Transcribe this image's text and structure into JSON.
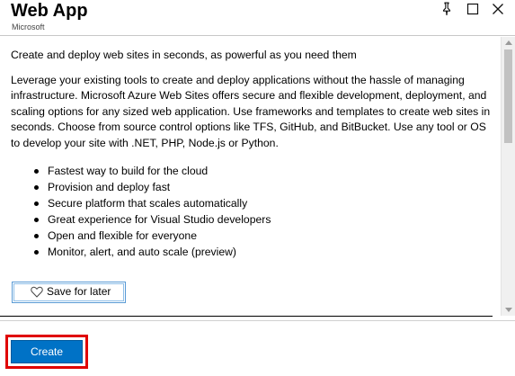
{
  "header": {
    "title": "Web App",
    "subtitle": "Microsoft"
  },
  "icons": {
    "pin": "pin-icon",
    "maximize": "maximize-icon",
    "close": "close-icon",
    "heart": "heart-icon"
  },
  "content": {
    "lead": "Create and deploy web sites in seconds, as powerful as you need them",
    "description": "Leverage your existing tools to create and deploy applications without the hassle of managing infrastructure. Microsoft Azure Web Sites offers secure and flexible development, deployment, and scaling options for any sized web application. Use frameworks and templates to create web sites in seconds. Choose from source control options like TFS, GitHub, and BitBucket. Use any tool or OS to develop your site with .NET, PHP, Node.js or Python.",
    "bullets": [
      "Fastest way to build for the cloud",
      "Provision and deploy fast",
      "Secure platform that scales automatically",
      "Great experience for Visual Studio developers",
      "Open and flexible for everyone",
      "Monitor, alert, and auto scale (preview)"
    ],
    "save_label": "Save for later"
  },
  "footer": {
    "create_label": "Create"
  },
  "colors": {
    "primary_button": "#0072c6",
    "highlight": "#e00000",
    "secondary_border": "#5a9bd5"
  }
}
